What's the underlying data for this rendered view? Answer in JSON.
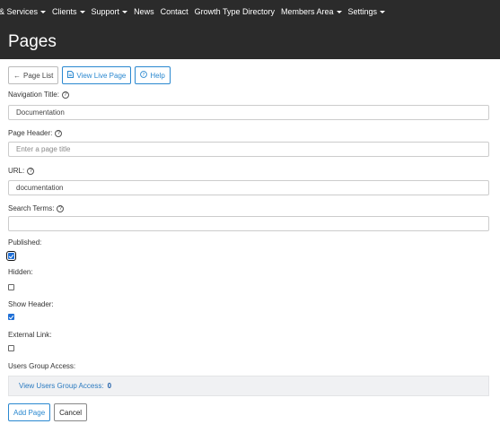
{
  "nav": {
    "items": [
      {
        "label": "& Services",
        "dropdown": true
      },
      {
        "label": "Clients",
        "dropdown": true
      },
      {
        "label": "Support",
        "dropdown": true
      },
      {
        "label": "News",
        "dropdown": false
      },
      {
        "label": "Contact",
        "dropdown": false
      },
      {
        "label": "Growth Type Directory",
        "dropdown": false
      },
      {
        "label": "Members Area",
        "dropdown": true
      },
      {
        "label": "Settings",
        "dropdown": true
      }
    ]
  },
  "page": {
    "title": "Pages"
  },
  "toolbar": {
    "page_list": "Page List",
    "view_live": "View Live Page",
    "help": "Help"
  },
  "form": {
    "nav_title_label": "Navigation Title:",
    "nav_title_value": "Documentation",
    "page_header_label": "Page Header:",
    "page_header_placeholder": "Enter a page title",
    "url_label": "URL:",
    "url_value": "documentation",
    "search_terms_label": "Search Terms:",
    "search_terms_value": "",
    "published_label": "Published:",
    "published_checked": true,
    "hidden_label": "Hidden:",
    "hidden_checked": false,
    "show_header_label": "Show Header:",
    "show_header_checked": true,
    "external_link_label": "External Link:",
    "external_link_checked": false,
    "users_group_label": "Users Group Access:",
    "users_group_link": "View Users Group Access:",
    "users_group_count": "0"
  },
  "footer": {
    "add_page": "Add Page",
    "cancel": "Cancel"
  },
  "colors": {
    "header_bg": "#2b2b2b",
    "accent": "#2a88d0",
    "checkbox_checked": "#1f6fd6"
  }
}
